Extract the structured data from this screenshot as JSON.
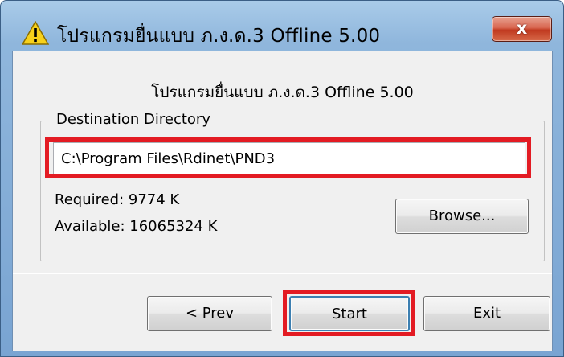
{
  "window": {
    "title": "โปรแกรมยื่นแบบ ภ.ง.ด.3  Offline 5.00",
    "close_label": "x"
  },
  "dialog": {
    "heading": "โปรแกรมยื่นแบบ ภ.ง.ด.3 Offline 5.00",
    "group_label": "Destination Directory",
    "destination_path": "C:\\Program Files\\Rdinet\\PND3",
    "required": "Required: 9774 K",
    "available": "Available: 16065324 K",
    "browse_label": "Browse..."
  },
  "buttons": {
    "prev_label": "< Prev",
    "start_label": "Start",
    "exit_label": "Exit"
  },
  "colors": {
    "highlight": "#e31b23",
    "title_bar": "#8fb6dc",
    "close_button": "#c0391f"
  },
  "icons": {
    "title_icon": "warning-icon"
  }
}
